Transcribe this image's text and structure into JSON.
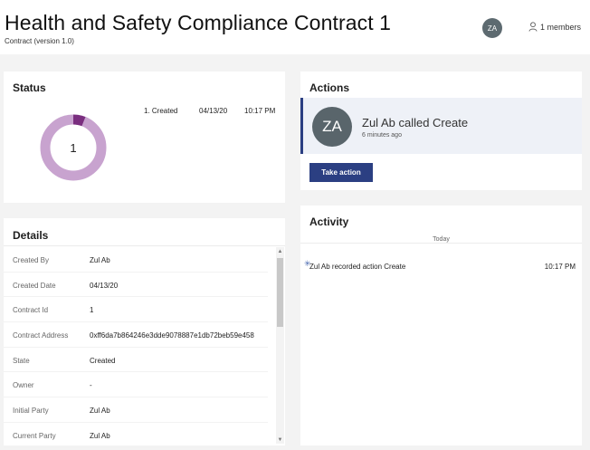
{
  "header": {
    "title": "Health and Safety Compliance Contract 1",
    "subtitle": "Contract (version 1.0)",
    "avatar_initials": "ZA",
    "members_label": "1 members"
  },
  "status": {
    "title": "Status",
    "donut_center": "1",
    "completed_fraction": 0.06,
    "colors": {
      "ring": "#c8a3cf",
      "segment": "#7a2e7f"
    },
    "entries": [
      {
        "label": "1. Created",
        "date": "04/13/20",
        "time": "10:17 PM"
      }
    ]
  },
  "details": {
    "title": "Details",
    "rows": [
      {
        "label": "Created By",
        "value": "Zul Ab"
      },
      {
        "label": "Created Date",
        "value": "04/13/20"
      },
      {
        "label": "Contract Id",
        "value": "1"
      },
      {
        "label": "Contract Address",
        "value": "0xff6da7b864246e3dde9078887e1db72beb59e458"
      },
      {
        "label": "State",
        "value": "Created"
      },
      {
        "label": "Owner",
        "value": "-"
      },
      {
        "label": "Initial Party",
        "value": "Zul Ab"
      },
      {
        "label": "Current Party",
        "value": "Zul Ab"
      }
    ]
  },
  "actions": {
    "title": "Actions",
    "avatar_initials": "ZA",
    "item_text": "Zul Ab called Create",
    "item_time": "6 minutes ago",
    "button_label": "Take action",
    "accent_color": "#2b3f82"
  },
  "activity": {
    "title": "Activity",
    "day_label": "Today",
    "entries": [
      {
        "text": "Zul Ab recorded action Create",
        "time": "10:17 PM"
      }
    ]
  }
}
